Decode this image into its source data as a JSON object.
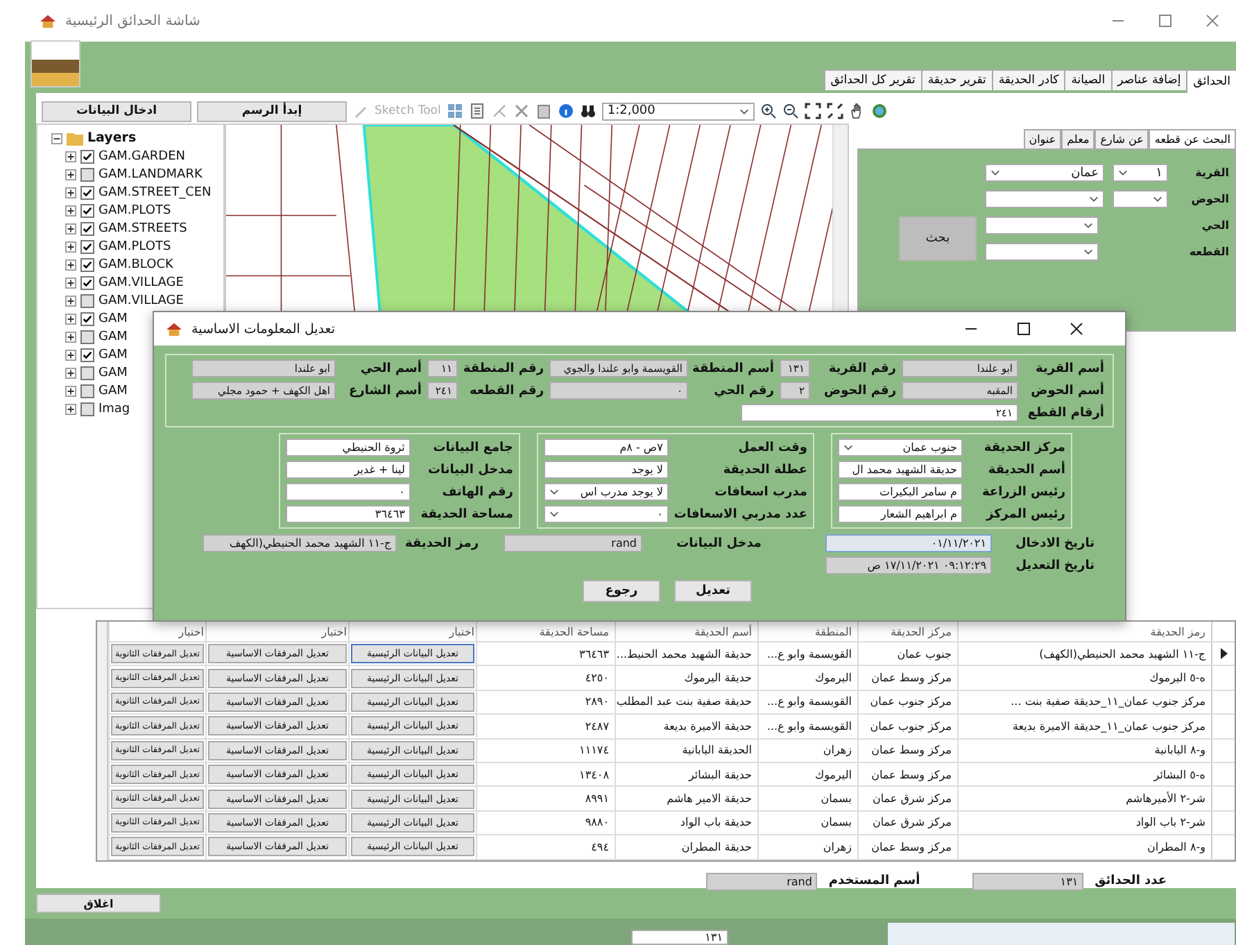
{
  "window": {
    "title": "شاشة الحدائق الرئيسية"
  },
  "tabs": [
    {
      "label": "الحدائق",
      "selected": true
    },
    {
      "label": "إضافة عناصر",
      "selected": false
    },
    {
      "label": "الصيانة",
      "selected": false
    },
    {
      "label": "كادر الحديقة",
      "selected": false
    },
    {
      "label": "تقرير حديقة",
      "selected": false
    },
    {
      "label": "تقرير كل الحدائق",
      "selected": false
    }
  ],
  "actions": {
    "data_entry": "ادخال البيانات",
    "start_drawing": "إبدأ الرسم"
  },
  "toolbar": {
    "sketch_tool": "Sketch Tool",
    "scale": "1:2,000"
  },
  "layers": {
    "title": "Layers",
    "items": [
      {
        "label": "GAM.GARDEN",
        "checked": true
      },
      {
        "label": "GAM.LANDMARK",
        "checked": false
      },
      {
        "label": "GAM.STREET_CEN",
        "checked": true
      },
      {
        "label": "GAM.PLOTS",
        "checked": true
      },
      {
        "label": "GAM.STREETS",
        "checked": true
      },
      {
        "label": "GAM.PLOTS",
        "checked": true
      },
      {
        "label": "GAM.BLOCK",
        "checked": true
      },
      {
        "label": "GAM.VILLAGE",
        "checked": true
      },
      {
        "label": "GAM.VILLAGE",
        "checked": false
      },
      {
        "label": "GAM",
        "checked": true
      },
      {
        "label": "GAM",
        "checked": false
      },
      {
        "label": "GAM",
        "checked": true
      },
      {
        "label": "GAM",
        "checked": false
      },
      {
        "label": "GAM",
        "checked": false
      },
      {
        "label": "Imag",
        "checked": false
      }
    ]
  },
  "search": {
    "tabs": [
      {
        "label": "البحث عن قطعه",
        "selected": true
      },
      {
        "label": "عن شارع",
        "selected": false
      },
      {
        "label": "معلم",
        "selected": false
      },
      {
        "label": "عنوان",
        "selected": false
      }
    ],
    "fields": [
      {
        "label": "القرية",
        "kind": "double",
        "values": [
          "١",
          "عمان"
        ]
      },
      {
        "label": "الحوض",
        "kind": "double"
      },
      {
        "label": "الحي",
        "kind": "single"
      },
      {
        "label": "القطعه",
        "kind": "single"
      }
    ],
    "button": "بحث"
  },
  "dialog": {
    "title": "تعديل المعلومات الاساسية",
    "location_rows": [
      [
        {
          "label": "أسم القرية",
          "value": "ابو علندا",
          "disabled": true
        },
        {
          "label": "رقم القرية",
          "value": "١٣١",
          "disabled": true
        },
        {
          "label": "أسم المنطقة",
          "value": "القويسمة وابو علندا والجوي",
          "disabled": true
        },
        {
          "label": "رقم المنطقة",
          "value": "١١",
          "disabled": true
        },
        {
          "label": "أسم الحي",
          "value": "ابو علندا",
          "disabled": true
        }
      ],
      [
        {
          "label": "أسم الحوض",
          "value": "المقبه",
          "disabled": true
        },
        {
          "label": "رقم الحوض",
          "value": "٢",
          "disabled": true
        },
        {
          "label": "رقم الحي",
          "value": "٠",
          "disabled": true
        },
        {
          "label": "رقم القطعه",
          "value": "٢٤١",
          "disabled": true
        },
        {
          "label": "أسم الشارع",
          "value": "اهل الكهف + حمود مجلي",
          "disabled": true
        }
      ],
      [
        {
          "label": "أرقام القطع",
          "value": "٢٤١",
          "disabled": false
        }
      ]
    ],
    "groups": [
      [
        {
          "label": "مركز الحديقة",
          "value": "جنوب عمان",
          "kind": "combo"
        },
        {
          "label": "أسم الحديقة",
          "value": "حديقة الشهيد محمد ال",
          "kind": "text"
        },
        {
          "label": "رئيس الزراعة",
          "value": "م سامر البكيرات",
          "kind": "text"
        },
        {
          "label": "رئيس المركز",
          "value": "م ابراهيم الشعار",
          "kind": "text"
        }
      ],
      [
        {
          "label": "وقت العمل",
          "value": "٧ص - ٨م",
          "kind": "text"
        },
        {
          "label": "عطلة الحديقة",
          "value": "لا يوجد",
          "kind": "text"
        },
        {
          "label": "مدرب اسعافات",
          "value": "لا يوجد مدرب اس",
          "kind": "combo"
        },
        {
          "label": "عدد مدربي الاسعافات",
          "value": "٠",
          "kind": "combo"
        }
      ],
      [
        {
          "label": "جامع البيانات",
          "value": "ثروة الحنيطي",
          "kind": "text"
        },
        {
          "label": "مدخل البيانات",
          "value": "لينا + غدير",
          "kind": "text"
        },
        {
          "label": "رقم الهاتف",
          "value": "٠",
          "kind": "text"
        },
        {
          "label": "مساحة الحديقة",
          "value": "٣٦٤٦٣",
          "kind": "text"
        }
      ]
    ],
    "entry_date": {
      "label": "تاريخ الادخال",
      "value": "٠١/١١/٢٠٢١"
    },
    "edit_date": {
      "label": "تاريخ التعديل",
      "value": "٠٩:١٢:٢٩ ١٧/١١/٢٠٢١ ص"
    },
    "entered_by": {
      "label": "مدخل البيانات",
      "value": "rand"
    },
    "garden_code": {
      "label": "رمز الحديقة",
      "value": "ج-١١ الشهيد محمد الحنيطي(الكهف"
    },
    "buttons": [
      "تعديل",
      "رجوع"
    ]
  },
  "table": {
    "columns": [
      "رمز الحديقة",
      "مركز الحديقة",
      "المنطقة",
      "أسم الحديقة",
      "مساحة الحديقة",
      "اختيار",
      "اختيار",
      "اختيار"
    ],
    "rows": [
      {
        "selected": true,
        "cells": [
          "ج-١١ الشهيد محمد الحنيطي(الكهف)",
          "جنوب عمان",
          "القويسمة وابو ع...",
          "حديقة الشهيد محمد الحنيط...",
          "٣٦٤٦٣"
        ],
        "actions": [
          "تعديل البيانات الرئيسية",
          "تعديل المرفقات الاساسية",
          "تعديل المرفقات الثانوية"
        ]
      },
      {
        "selected": false,
        "cells": [
          "ه-٥ اليرموك",
          "مركز وسط عمان",
          "اليرموك",
          "حديقة اليرموك",
          "٤٢٥٠"
        ],
        "actions": [
          "تعديل البيانات الرئيسية",
          "تعديل المرفقات الاساسية",
          "تعديل المرفقات الثانوية"
        ]
      },
      {
        "selected": false,
        "cells": [
          "مركز جنوب عمان_١١_حديقة صفية بنت ...",
          "مركز جنوب عمان",
          "القويسمة وابو ع...",
          "حديقة صفية بنت عبد المطلب",
          "٢٨٩٠"
        ],
        "actions": [
          "تعديل البيانات الرئيسية",
          "تعديل المرفقات الاساسية",
          "تعديل المرفقات الثانوية"
        ]
      },
      {
        "selected": false,
        "cells": [
          "مركز جنوب عمان_١١_حديقة الاميرة بديعة",
          "مركز جنوب عمان",
          "القويسمة وابو ع...",
          "حديقة الاميرة بديعة",
          "٢٤٨٧"
        ],
        "actions": [
          "تعديل البيانات الرئيسية",
          "تعديل المرفقات الاساسية",
          "تعديل المرفقات الثانوية"
        ]
      },
      {
        "selected": false,
        "cells": [
          "و-٨ اليابانية",
          "مركز وسط عمان",
          "زهران",
          "الحديقة اليابانية",
          "١١١٧٤"
        ],
        "actions": [
          "تعديل البيانات الرئيسية",
          "تعديل المرفقات الاساسية",
          "تعديل المرفقات الثانوية"
        ]
      },
      {
        "selected": false,
        "cells": [
          "ه-٥ البشائر",
          "مركز وسط عمان",
          "اليرموك",
          "حديقة البشائر",
          "١٣٤٠٨"
        ],
        "actions": [
          "تعديل البيانات الرئيسية",
          "تعديل المرفقات الاساسية",
          "تعديل المرفقات الثانوية"
        ]
      },
      {
        "selected": false,
        "cells": [
          "شر-٢ الأميرهاشم",
          "مركز شرق عمان",
          "بسمان",
          "حديقة الامير هاشم",
          "٨٩٩١"
        ],
        "actions": [
          "تعديل البيانات الرئيسية",
          "تعديل المرفقات الاساسية",
          "تعديل المرفقات الثانوية"
        ]
      },
      {
        "selected": false,
        "cells": [
          "شر-٢ باب الواد",
          "مركز شرق عمان",
          "بسمان",
          "حديقة باب الواد",
          "٩٨٨٠"
        ],
        "actions": [
          "تعديل البيانات الرئيسية",
          "تعديل المرفقات الاساسية",
          "تعديل المرفقات الثانوية"
        ]
      },
      {
        "selected": false,
        "cells": [
          "و-٨ المطران",
          "مركز وسط عمان",
          "زهران",
          "حديقة المطران",
          "٤٩٤"
        ],
        "actions": [
          "تعديل البيانات الرئيسية",
          "تعديل المرفقات الاساسية",
          "تعديل المرفقات الثانوية"
        ]
      }
    ]
  },
  "summary": {
    "count_label": "عدد الحدائق",
    "count": "١٣١",
    "user_label": "أسم المستخدم",
    "user": "rand"
  },
  "close_button": "اغلاق",
  "status_field": "١٣١"
}
